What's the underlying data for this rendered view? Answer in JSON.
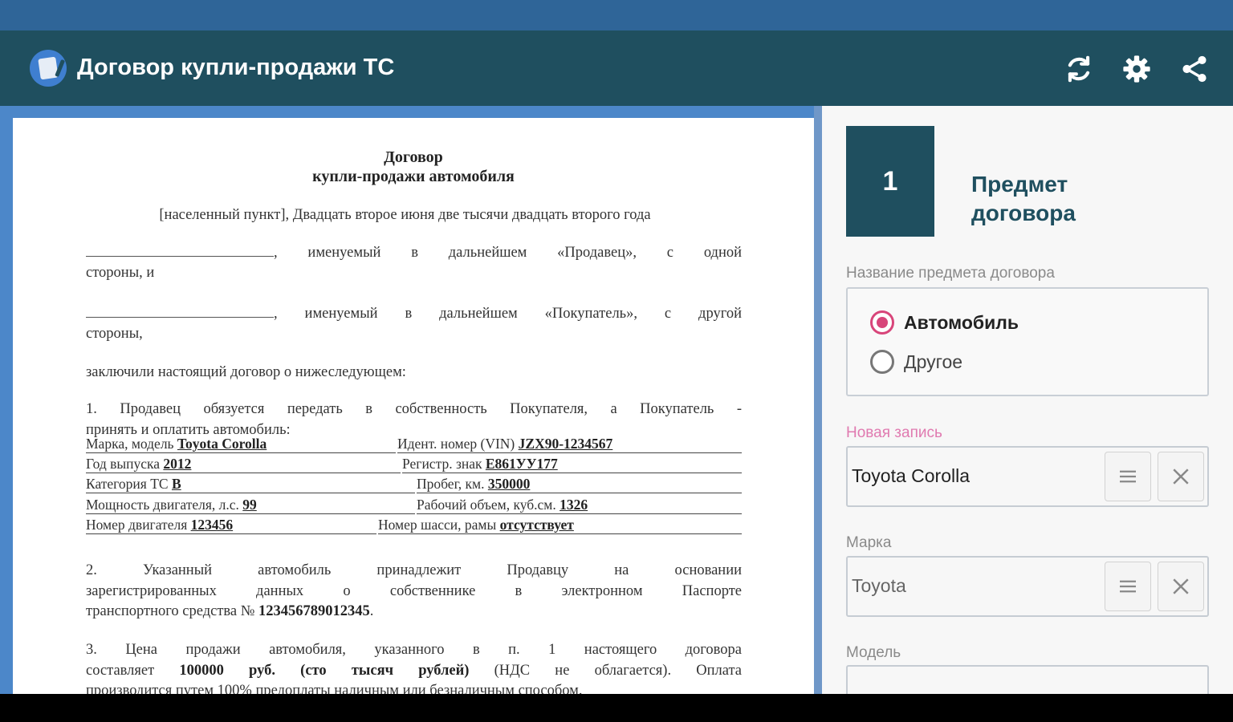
{
  "app": {
    "title": "Договор купли-продажи ТС",
    "icons": [
      "app-logo-icon",
      "refresh-icon",
      "settings-icon",
      "share-icon"
    ],
    "colors": {
      "status_bar": "#2f6598",
      "app_bar": "#1f4f5f",
      "accent": "#d8457a"
    }
  },
  "document": {
    "title_line1": "Договор",
    "title_line2": "купли-продажи автомобиля",
    "place_date": "[населенный пункт], Двадцать второе июня две тысячи двадцать второго года",
    "seller_a": ", именуемый в дальнейшем «Продавец», с одной",
    "seller_b": "стороны, и",
    "buyer_a": ", именуемый в дальнейшем «Покупатель», с другой",
    "buyer_b": "стороны,",
    "concluded": "заключили настоящий договор о нижеследующем:",
    "p1_a": "1. Продавец обязуется передать в собственность Покупателя, а Покупатель -",
    "p1_b": "принять и оплатить автомобиль:",
    "fields": {
      "make_label": "Марка, модель",
      "make_value": "Toyota Corolla",
      "vin_label": "Идент. номер (VIN)",
      "vin_value": "JZX90-1234567",
      "year_label": "Год выпуска",
      "year_value": "2012",
      "plate_label": "Регистр. знак",
      "plate_value": "Е861УУ177",
      "category_label": "Категория ТС",
      "category_value": "В",
      "mileage_label": "Пробег, км.",
      "mileage_value": "350000",
      "power_label": "Мощность двигателя, л.с.",
      "power_value": "99",
      "volume_label": "Рабочий объем, куб.см.",
      "volume_value": "1326",
      "engine_label": "Номер двигателя",
      "engine_value": "123456",
      "chassis_label": "Номер шасси, рамы",
      "chassis_value": "отсутствует"
    },
    "p2_a": "2. Указанный автомобиль принадлежит Продавцу на основании",
    "p2_b": "зарегистрированных данных о собственнике в электронном Паспорте",
    "p2_c_text": "транспортного средства №",
    "p2_c_num": "123456789012345",
    "p3_a": "3. Цена продажи автомобиля, указанного в п. 1 настоящего договора",
    "p3_b_pre": "составляет",
    "p3_b_bold": "100000 руб. (сто тысяч рублей)",
    "p3_b_post": "(НДС не облагается). Оплата",
    "p3_c": "производится путем 100% предоплаты наличным или безналичным способом."
  },
  "form": {
    "step_number": "1",
    "step_title_1": "Предмет",
    "step_title_2": "договора",
    "subject_label": "Название предмета договора",
    "radio_options": [
      {
        "label": "Автомобиль",
        "selected": true
      },
      {
        "label": "Другое",
        "selected": false
      }
    ],
    "new_entry_label": "Новая запись",
    "new_entry_value": "Toyota Corolla",
    "brand_label": "Марка",
    "brand_value": "Toyota",
    "model_label": "Модель",
    "button_icons": [
      "menu-icon",
      "close-icon"
    ]
  }
}
